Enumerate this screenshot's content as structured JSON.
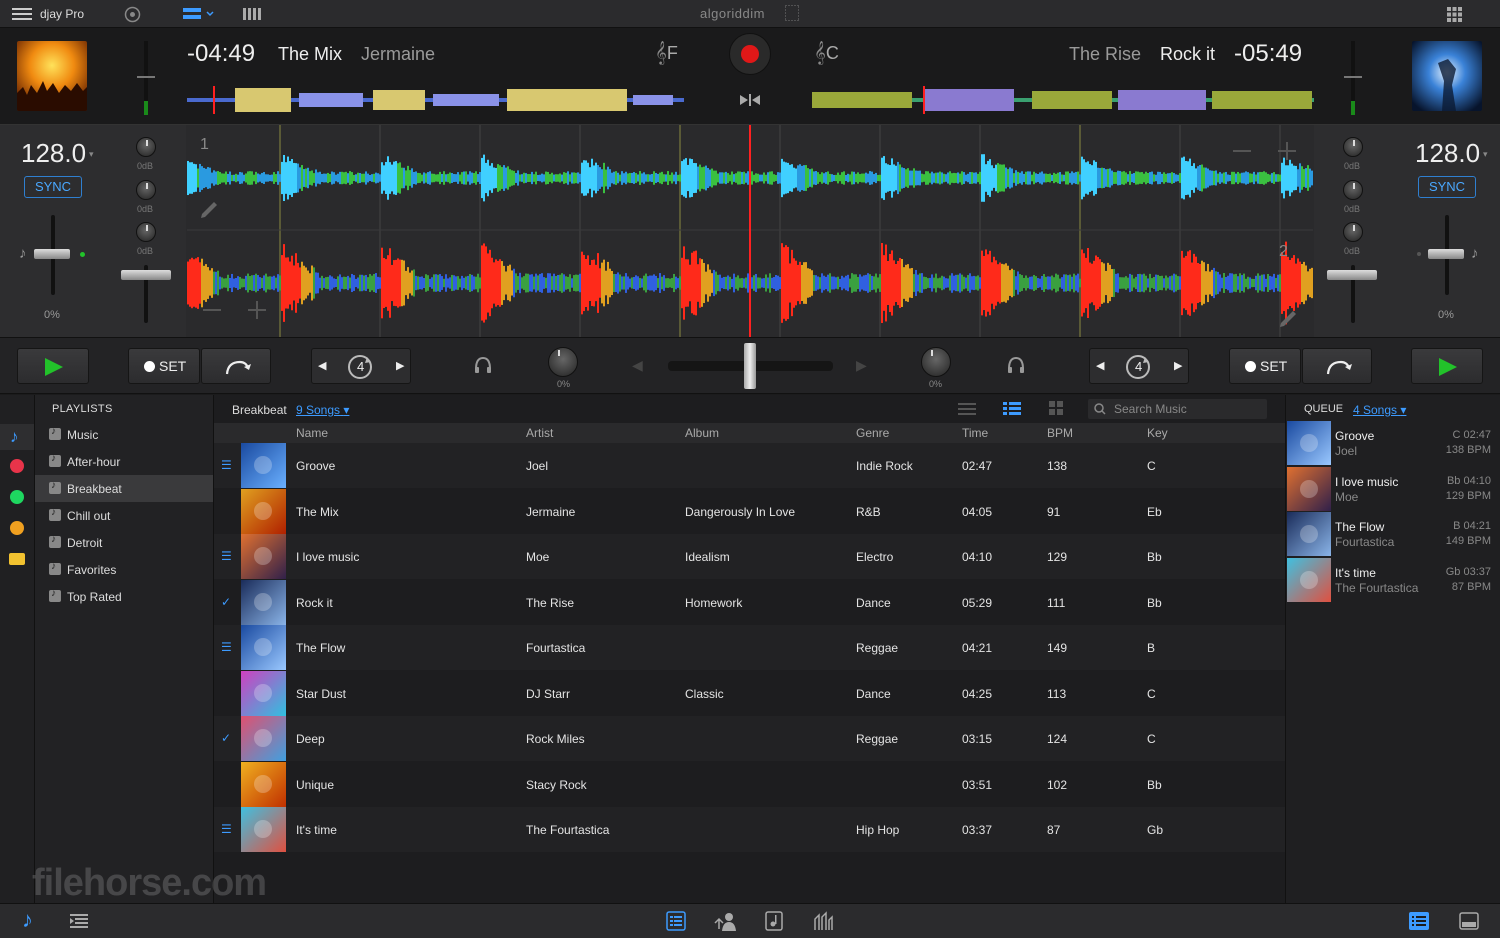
{
  "app": {
    "name": "djay Pro",
    "brand": "algoriddim"
  },
  "deck_left": {
    "time": "-04:49",
    "title": "The Mix",
    "artist": "Jermaine",
    "key": "F",
    "bpm": "128.0",
    "sync": "SYNC",
    "pitch": "0%",
    "deck_number": "1"
  },
  "deck_right": {
    "time": "-05:49",
    "title": "Rock it",
    "artist": "The Rise",
    "key": "C",
    "bpm": "128.0",
    "sync": "SYNC",
    "pitch": "0%",
    "deck_number": "2"
  },
  "mixer": {
    "eq_label": "0dB",
    "gain_left": "0%",
    "gain_right": "0%"
  },
  "transport": {
    "set_label": "SET",
    "loop_size": "4"
  },
  "sidebar": {
    "header": "PLAYLISTS",
    "items": [
      {
        "label": "Music"
      },
      {
        "label": "After-hour"
      },
      {
        "label": "Breakbeat"
      },
      {
        "label": "Chill out"
      },
      {
        "label": "Detroit"
      },
      {
        "label": "Favorites"
      },
      {
        "label": "Top Rated"
      }
    ]
  },
  "library": {
    "crumb": "Breakbeat",
    "songs_count": "9 Songs",
    "search_placeholder": "Search Music",
    "columns": {
      "name": "Name",
      "artist": "Artist",
      "album": "Album",
      "genre": "Genre",
      "time": "Time",
      "bpm": "BPM",
      "key": "Key"
    },
    "rows": [
      {
        "mark": "☰",
        "name": "Groove",
        "artist": "Joel",
        "album": "",
        "genre": "Indie Rock",
        "time": "02:47",
        "bpm": "138",
        "key": "C"
      },
      {
        "mark": "",
        "name": "The Mix",
        "artist": "Jermaine",
        "album": "Dangerously In Love",
        "genre": "R&B",
        "time": "04:05",
        "bpm": "91",
        "key": "Eb"
      },
      {
        "mark": "☰",
        "name": "I love music",
        "artist": "Moe",
        "album": "Idealism",
        "genre": "Electro",
        "time": "04:10",
        "bpm": "129",
        "key": "Bb"
      },
      {
        "mark": "✓",
        "name": "Rock it",
        "artist": "The Rise",
        "album": "Homework",
        "genre": "Dance",
        "time": "05:29",
        "bpm": "111",
        "key": "Bb"
      },
      {
        "mark": "☰",
        "name": "The Flow",
        "artist": "Fourtastica",
        "album": "",
        "genre": "Reggae",
        "time": "04:21",
        "bpm": "149",
        "key": "B"
      },
      {
        "mark": "",
        "name": "Star Dust",
        "artist": "DJ Starr",
        "album": "Classic",
        "genre": "Dance",
        "time": "04:25",
        "bpm": "113",
        "key": "C"
      },
      {
        "mark": "✓",
        "name": "Deep",
        "artist": "Rock Miles",
        "album": "",
        "genre": "Reggae",
        "time": "03:15",
        "bpm": "124",
        "key": "C"
      },
      {
        "mark": "",
        "name": "Unique",
        "artist": "Stacy Rock",
        "album": "",
        "genre": "",
        "time": "03:51",
        "bpm": "102",
        "key": "Bb"
      },
      {
        "mark": "☰",
        "name": "It's time",
        "artist": "The Fourtastica",
        "album": "",
        "genre": "Hip Hop",
        "time": "03:37",
        "bpm": "87",
        "key": "Gb"
      }
    ]
  },
  "queue": {
    "header": "QUEUE",
    "count": "4 Songs",
    "items": [
      {
        "title": "Groove",
        "artist": "Joel",
        "key_time": "C 02:47",
        "bpm": "138 BPM"
      },
      {
        "title": "I love music",
        "artist": "Moe",
        "key_time": "Bb 04:10",
        "bpm": "129 BPM"
      },
      {
        "title": "The Flow",
        "artist": "Fourtastica",
        "key_time": "B 04:21",
        "bpm": "149 BPM"
      },
      {
        "title": "It's time",
        "artist": "The Fourtastica",
        "key_time": "Gb 03:37",
        "bpm": "87 BPM"
      }
    ]
  },
  "watermark": "filehorse.com",
  "colors": {
    "accent": "#3d9bff",
    "play": "#22c22a",
    "record": "#e01818",
    "playhead": "#ff2020"
  }
}
